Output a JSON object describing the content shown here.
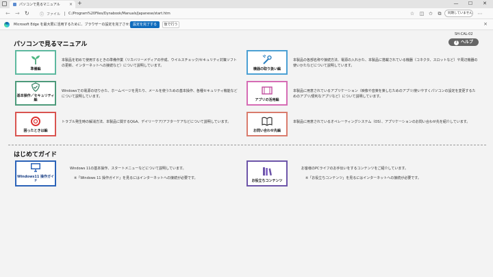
{
  "browser": {
    "tab_title": "パソコンで見るマニュアル",
    "tab_close": "×",
    "new_tab": "+",
    "window_controls": [
      "—",
      "☐",
      "✕"
    ],
    "address_label": "ファイル",
    "url": "C:/Program%20Files/Dynabook/Manuals/Japanese/start.htm",
    "profile_label": "同期していません"
  },
  "infobar": {
    "text": "Microsoft Edge を最大限に活用するために、ブラウザーの設定を完了させましょう。",
    "primary_button": "設定を完了する",
    "secondary_button": "後で行う",
    "close": "×"
  },
  "page": {
    "doc_code": "SH-CAL-02",
    "help_label": "ヘルプ",
    "help_q": "?",
    "section1_title": "パソコンで見るマニュアル",
    "section2_title": "はじめてガイド",
    "cards": [
      {
        "label": "準備編",
        "color": "#5cb89e",
        "icon": "sprout-icon",
        "desc": "本製品を初めて使用するときの準備作業（リカバリーメディアの作成、ウイルスチェック/セキュリティ対策ソフトの更新、インターネットへの接続など）について説明しています。"
      },
      {
        "label": "機器の取り扱い編",
        "color": "#4a9fd3",
        "icon": "tools-icon",
        "desc": "本製品の各部名称や接続方法、電源の入れかた、本製品に搭載されている機器（コネクタ、スロットなど）や周辺機器の使いかたなどについて説明しています。"
      },
      {
        "label": "基本操作／セキュリティ編",
        "color": "#4c9a7a",
        "icon": "shield-icon",
        "desc": "Windowsでの電源の切りかた、ホームページを見たり、メールを使うための基本操作、各種セキュリティ機能などについて説明しています。"
      },
      {
        "label": "アプリの活用編",
        "color": "#d56bb4",
        "icon": "film-icon",
        "desc": "本製品に用意されているアプリケーション（映像や音楽を楽しむためのアプリ/使いやすくパソコンの設定を変更するためのアプリ/便利なアプリなど）について説明しています。"
      },
      {
        "label": "困ったときは編",
        "color": "#d9534f",
        "icon": "lifebuoy-icon",
        "desc": "トラブル発生時の解消方法、本製品に関するQ&A、デイリーケア/アフターケアなどについて説明しています。"
      },
      {
        "label": "お問い合わせ先編",
        "color": "#d97b6c",
        "icon": "book-icon",
        "desc": "本製品に用意されているオペレーティングシステム（OS）、アプリケーションのお問い合わせ先を紹介しています。"
      }
    ],
    "guides": [
      {
        "label": "Windows11 操作ガイド",
        "color": "#2a62b8",
        "icon": "monitor-icon",
        "desc": "Windows 11の基本操作、スタートメニューなどについて説明しています。",
        "note": "※「Windows 11 操作ガイド」を見るにはインターネットへの接続が必要です。"
      },
      {
        "label": "お役立ちコンテンツ",
        "color": "#6c54a8",
        "icon": "books-icon",
        "desc": "お客様のPCライフのお手伝いをするコンテンツをご紹介しています。",
        "note": "※「お役立ちコンテンツ」を見るにはインターネットへの接続が必要です。"
      }
    ]
  }
}
